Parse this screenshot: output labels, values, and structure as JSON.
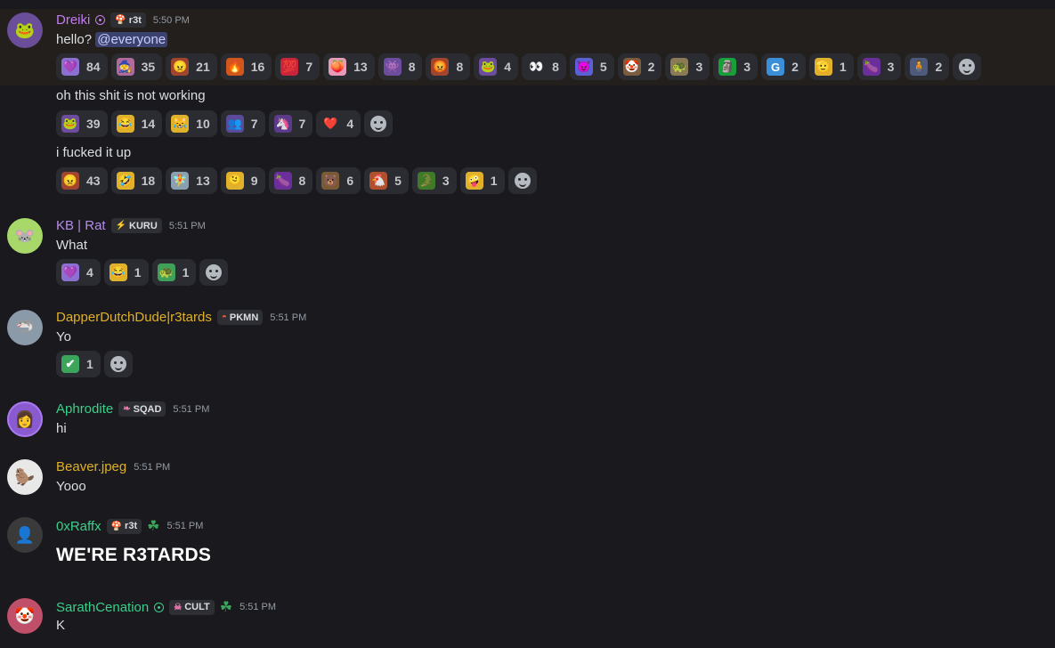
{
  "messages": [
    {
      "author": "Dreiki",
      "name_color": "#c27cf2",
      "tag": "r3t",
      "tag_icon": "mushroom-icon",
      "time": "5:50 PM",
      "avatar_color": "#6a4e9a",
      "avatar_glyph": "🐸",
      "text_prefix": "hello?",
      "mention": "@everyone",
      "reactions": [
        {
          "emoji": "💜",
          "count": "84",
          "bg": "#8b6fd1"
        },
        {
          "emoji": "🧙",
          "count": "35",
          "bg": "#b06a9b"
        },
        {
          "emoji": "😠",
          "count": "21",
          "bg": "#a0452e"
        },
        {
          "emoji": "🔥",
          "count": "16",
          "bg": "#d2561b"
        },
        {
          "emoji": "💯",
          "count": "7",
          "bg": "#c9253a"
        },
        {
          "emoji": "🍑",
          "count": "13",
          "bg": "#e89ab8"
        },
        {
          "emoji": "👾",
          "count": "8",
          "bg": "#6d4c9e"
        },
        {
          "emoji": "😡",
          "count": "8",
          "bg": "#a0452e"
        },
        {
          "emoji": "🐸",
          "count": "4",
          "bg": "#6d4c9e"
        },
        {
          "emoji": "👀",
          "count": "8",
          "bg": "#2b2c31"
        },
        {
          "emoji": "😈",
          "count": "5",
          "bg": "#5d5fd6"
        },
        {
          "emoji": "🤡",
          "count": "2",
          "bg": "#7b5c3e"
        },
        {
          "emoji": "🐢",
          "count": "3",
          "bg": "#8a7b55"
        },
        {
          "emoji": "🗿",
          "count": "3",
          "bg": "#17a03a"
        },
        {
          "emoji": "G",
          "count": "2",
          "bg": "#3b8fd9"
        },
        {
          "emoji": "🫡",
          "count": "1",
          "bg": "#e0b22b"
        },
        {
          "emoji": "🍆",
          "count": "3",
          "bg": "#6a2f9a"
        },
        {
          "emoji": "🧍",
          "count": "2",
          "bg": "#4e5a7c"
        }
      ]
    },
    {
      "text": "oh this shit is not working",
      "reactions": [
        {
          "emoji": "🐸",
          "count": "39",
          "bg": "#6d4c9e"
        },
        {
          "emoji": "😂",
          "count": "14",
          "bg": "#e0b22b"
        },
        {
          "emoji": "😹",
          "count": "10",
          "bg": "#e0b22b"
        },
        {
          "emoji": "👥",
          "count": "7",
          "bg": "#5b4a9a"
        },
        {
          "emoji": "🦄",
          "count": "7",
          "bg": "#5b3a8a"
        },
        {
          "emoji": "❤️",
          "count": "4",
          "bg": "#2b2c31"
        }
      ]
    },
    {
      "text": "i fucked it up",
      "reactions": [
        {
          "emoji": "😠",
          "count": "43",
          "bg": "#a0452e"
        },
        {
          "emoji": "🤣",
          "count": "18",
          "bg": "#e0b22b"
        },
        {
          "emoji": "🧚",
          "count": "13",
          "bg": "#8aa0b0"
        },
        {
          "emoji": "🫠",
          "count": "9",
          "bg": "#e0b22b"
        },
        {
          "emoji": "🍆",
          "count": "8",
          "bg": "#6a2f9a"
        },
        {
          "emoji": "🐻",
          "count": "6",
          "bg": "#7a5a32"
        },
        {
          "emoji": "🐔",
          "count": "5",
          "bg": "#b0502e"
        },
        {
          "emoji": "🐊",
          "count": "3",
          "bg": "#3f7a2a"
        },
        {
          "emoji": "🤪",
          "count": "1",
          "bg": "#e0b22b"
        }
      ]
    },
    {
      "author": "KB | Rat",
      "name_color": "#b48ce8",
      "tag": "KURU",
      "tag_icon": "bolt-icon",
      "time": "5:51 PM",
      "avatar_color": "#a8d86a",
      "avatar_glyph": "🐭",
      "text": "What",
      "reactions": [
        {
          "emoji": "💜",
          "count": "4",
          "bg": "#8b6fd1"
        },
        {
          "emoji": "😂",
          "count": "1",
          "bg": "#e0b22b"
        },
        {
          "emoji": "🐢",
          "count": "1",
          "bg": "#3fa05a"
        }
      ]
    },
    {
      "author": "DapperDutchDude|r3tards",
      "name_color": "#e0b02a",
      "tag": "PKMN",
      "tag_icon": "pokeball-icon",
      "time": "5:51 PM",
      "avatar_color": "#8a9aa8",
      "avatar_glyph": "🦈",
      "text": "Yo",
      "reactions": [
        {
          "emoji": "✔",
          "count": "1",
          "bg": "#3ba55c"
        }
      ]
    },
    {
      "author": "Aphrodite",
      "name_color": "#3bcf8a",
      "tag": "SQAD",
      "tag_icon": "feather-icon",
      "time": "5:51 PM",
      "avatar_color": "#8a5ad0",
      "avatar_glyph": "👩",
      "text": "hi"
    },
    {
      "author": "Beaver.jpeg",
      "name_color": "#e0b02a",
      "time": "5:51 PM",
      "avatar_color": "#e8e8e8",
      "avatar_glyph": "🦫",
      "text": "Yooo"
    },
    {
      "author": "0xRaffx",
      "name_color": "#3bcf8a",
      "tag": "r3t",
      "tag_icon": "mushroom-icon",
      "time": "5:51 PM",
      "avatar_color": "#3a3a3a",
      "avatar_glyph": "👤",
      "text": "WE'RE R3TARDS"
    },
    {
      "author": "SarathCenation",
      "name_color": "#3bcf8a",
      "tag": "CULT",
      "tag_icon": "skull-icon",
      "time": "5:51 PM",
      "avatar_color": "#c0506a",
      "avatar_glyph": "🤡",
      "text": "K"
    }
  ]
}
